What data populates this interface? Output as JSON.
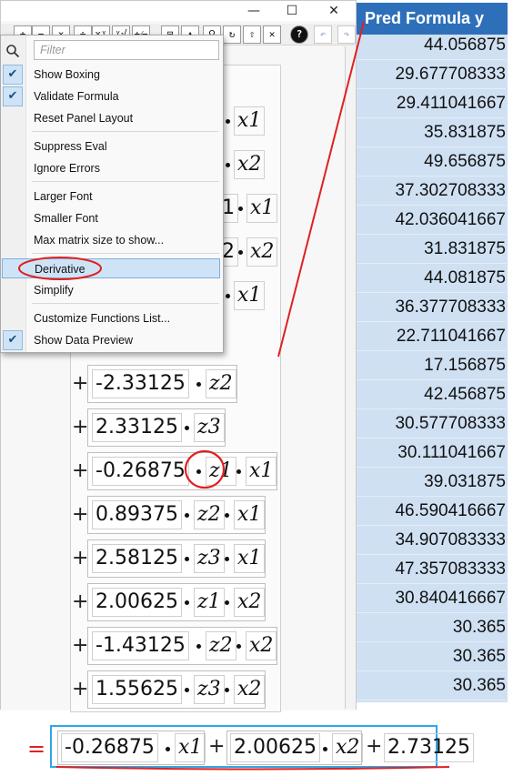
{
  "window": {
    "controls": {
      "minimize": "—",
      "maximize": "☐",
      "close": "✕"
    }
  },
  "toolbar": {
    "buttons": [
      {
        "icon": "plus-icon",
        "glyph": "+"
      },
      {
        "icon": "minus-icon",
        "glyph": "−"
      },
      {
        "icon": "times-icon",
        "glyph": "×"
      },
      {
        "icon": "divide-icon",
        "glyph": "÷"
      },
      {
        "icon": "power-icon",
        "glyph": "xʸ"
      },
      {
        "icon": "root-icon",
        "glyph": "ʸ√"
      },
      {
        "icon": "negate-icon",
        "glyph": "+⁄−"
      },
      {
        "icon": "eval-icon",
        "glyph": "⊟"
      },
      {
        "icon": "up-icon",
        "glyph": "▲"
      },
      {
        "icon": "search-icon",
        "glyph": "⚲"
      },
      {
        "icon": "cycle-icon",
        "glyph": "↻"
      },
      {
        "icon": "peel-icon",
        "glyph": "⇧"
      },
      {
        "icon": "delete-icon",
        "glyph": "✕"
      },
      {
        "icon": "help-icon",
        "glyph": "?"
      },
      {
        "icon": "undo-icon",
        "glyph": "↶"
      },
      {
        "icon": "redo-icon",
        "glyph": "↷"
      }
    ]
  },
  "menu": {
    "filter_placeholder": "Filter",
    "items": [
      {
        "label": "Show Boxing",
        "checked": true
      },
      {
        "label": "Validate Formula",
        "checked": true
      },
      {
        "label": "Reset Panel Layout",
        "checked": false
      },
      {
        "label": "Suppress Eval",
        "checked": false
      },
      {
        "label": "Ignore Errors",
        "checked": false
      },
      {
        "label": "Larger Font",
        "checked": false
      },
      {
        "label": "Smaller Font",
        "checked": false
      },
      {
        "label": "Max matrix size to show...",
        "checked": false
      },
      {
        "label": "Derivative",
        "checked": false,
        "highlighted": true
      },
      {
        "label": "Simplify",
        "checked": false
      },
      {
        "label": "Customize Functions List...",
        "checked": false
      },
      {
        "label": "Show Data Preview",
        "checked": true
      }
    ]
  },
  "formula": {
    "partial_rows": [
      {
        "vars": [
          "x1"
        ]
      },
      {
        "vars": [
          "x2"
        ]
      },
      {
        "frag": "1",
        "vars": [
          "x1"
        ]
      },
      {
        "frag": "2",
        "vars": [
          "x2"
        ]
      },
      {
        "vars": [
          "x1"
        ]
      }
    ],
    "rows": [
      {
        "coef": "-2.33125",
        "vars": [
          "z2"
        ]
      },
      {
        "coef": "2.33125",
        "vars": [
          "z3"
        ]
      },
      {
        "coef": "-0.26875",
        "vars": [
          "z1",
          "x1"
        ]
      },
      {
        "coef": "0.89375",
        "vars": [
          "z2",
          "x1"
        ]
      },
      {
        "coef": "2.58125",
        "vars": [
          "z3",
          "x1"
        ]
      },
      {
        "coef": "2.00625",
        "vars": [
          "z1",
          "x2"
        ]
      },
      {
        "coef": "-1.43125",
        "vars": [
          "z2",
          "x2"
        ]
      },
      {
        "coef": "1.55625",
        "vars": [
          "z3",
          "x2"
        ]
      }
    ],
    "plus": "+"
  },
  "table": {
    "header": "Pred Formula y",
    "values": [
      "44.056875",
      "29.677708333",
      "29.411041667",
      "35.831875",
      "49.656875",
      "37.302708333",
      "42.036041667",
      "31.831875",
      "44.081875",
      "36.377708333",
      "22.711041667",
      "17.156875",
      "42.456875",
      "30.577708333",
      "30.111041667",
      "39.031875",
      "46.590416667",
      "34.907083333",
      "47.357083333",
      "30.840416667",
      "30.365",
      "30.365",
      "30.365"
    ]
  },
  "result": {
    "equals": "=",
    "terms": [
      {
        "coef": "-0.26875",
        "var": "x1"
      },
      {
        "coef": "2.00625",
        "var": "x2"
      }
    ],
    "constant": "2.73125",
    "plus": "+"
  },
  "colors": {
    "header_bg": "#2e6fba",
    "table_bg": "#cfe0f2",
    "annotation_red": "#e02020",
    "result_border": "#2fa6e6",
    "menu_highlight": "#cfe3f7"
  }
}
